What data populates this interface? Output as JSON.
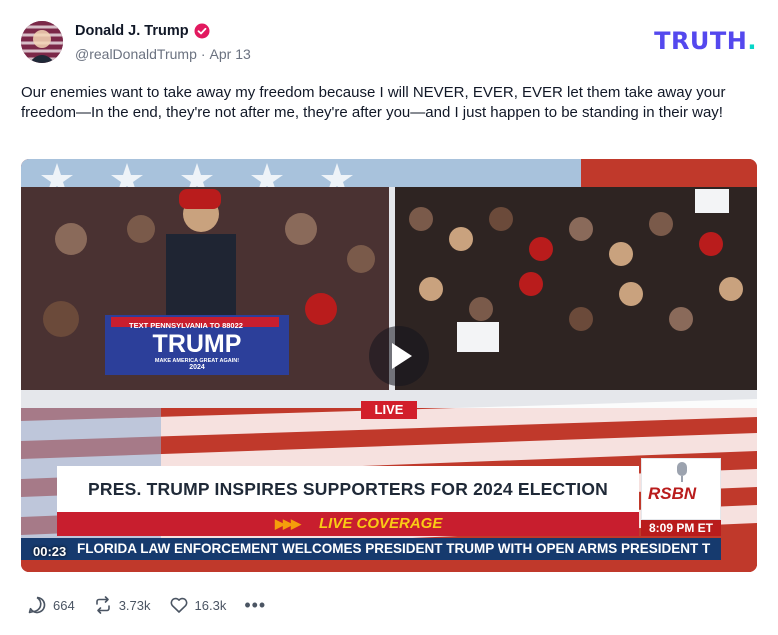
{
  "post": {
    "display_name": "Donald J. Trump",
    "handle": "@realDonaldTrump",
    "separator": "·",
    "date": "Apr 13",
    "text": "Our enemies want to take away my freedom because I will NEVER, EVER, EVER let them take away your freedom—In the end, they're not after me, they're after you—and I just happen to be standing in their way!"
  },
  "brand": {
    "name": "TRUTH",
    "dot": "."
  },
  "video": {
    "duration": "00:23",
    "live_label": "LIVE",
    "headline": "PRES. TRUMP INSPIRES SUPPORTERS FOR 2024 ELECTION",
    "coverage_label": "LIVE COVERAGE",
    "network": "RSBN",
    "time": "8:09 PM ET",
    "ticker": "FLORIDA LAW ENFORCEMENT WELCOMES PRESIDENT TRUMP WITH OPEN ARMS   PRESIDENT T",
    "sign_line1": "TEXT PENNSYLVANIA TO 88022",
    "sign_name": "TRUMP",
    "sign_line2": "MAKE AMERICA GREAT AGAIN!",
    "sign_year": "2024"
  },
  "actions": {
    "replies": "664",
    "retruths": "3.73k",
    "likes": "16.3k",
    "more": "•••"
  },
  "colors": {
    "brand": "#5448ee",
    "brand_dot": "#06d6c8",
    "verified": "#e2195f",
    "live_red": "#d21f2b",
    "ticker_blue": "#163a6e"
  }
}
